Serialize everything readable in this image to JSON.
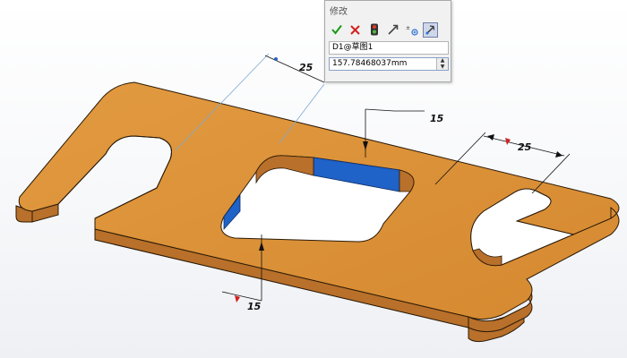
{
  "dialog": {
    "title": "修改",
    "confirm_icon": "check-icon",
    "cancel_icon": "x-icon",
    "name_field_value": "D1@草图1",
    "value_field_value": "157.78468037mm",
    "spin_up": "▲",
    "spin_down": "▼"
  },
  "dimensions": {
    "top_left": "25",
    "pocket_top": "15",
    "right_slot": "25",
    "pocket_bottom": "15"
  },
  "colors": {
    "part_face": "#d98e36",
    "part_side": "#b8702a",
    "part_edge": "#2b1a08",
    "selected_face": "#1f62c8",
    "dimension_line": "#111111",
    "dimension_blue": "#7da8d6",
    "arrow_red": "#d22020"
  }
}
